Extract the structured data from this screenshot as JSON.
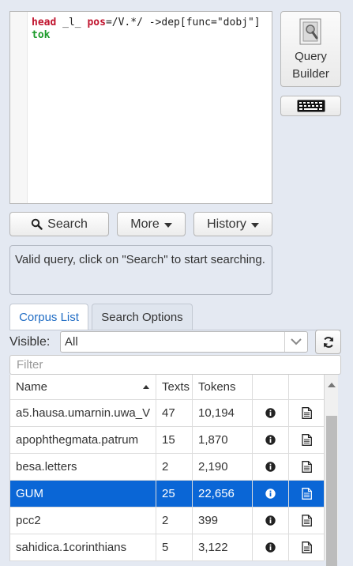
{
  "editor": {
    "query_parts": {
      "p1": "head",
      "p2": " _l_ ",
      "p3": "pos",
      "p4": "=/V.*/ -",
      "p5": ">dep[",
      "p6": "func",
      "p7": "=\"dobj\"] ",
      "p8": "tok"
    }
  },
  "query_builder": {
    "label": "Query Builder",
    "icon": "query-builder-icon"
  },
  "keyboard": {
    "icon": "keyboard-icon"
  },
  "buttons": {
    "search": "Search",
    "more": "More",
    "history": "History"
  },
  "status": {
    "message": "Valid query, click on \"Search\" to start searching."
  },
  "tabs": [
    {
      "label": "Corpus List",
      "active": true
    },
    {
      "label": "Search Options",
      "active": false
    }
  ],
  "visible": {
    "label": "Visible:",
    "value": "All"
  },
  "filter": {
    "placeholder": "Filter"
  },
  "table": {
    "columns": [
      "Name",
      "Texts",
      "Tokens"
    ],
    "rows": [
      {
        "name": "a5.hausa.umarnin.uwa_V",
        "texts": "47",
        "tokens": "10,194",
        "selected": false
      },
      {
        "name": "apophthegmata.patrum",
        "texts": "15",
        "tokens": "1,870",
        "selected": false
      },
      {
        "name": "besa.letters",
        "texts": "2",
        "tokens": "2,190",
        "selected": false
      },
      {
        "name": "GUM",
        "texts": "25",
        "tokens": "22,656",
        "selected": true
      },
      {
        "name": "pcc2",
        "texts": "2",
        "tokens": "399",
        "selected": false
      },
      {
        "name": "sahidica.1corinthians",
        "texts": "5",
        "tokens": "3,122",
        "selected": false
      }
    ]
  },
  "colors": {
    "accent": "#0a66d6",
    "tab_active_text": "#1f6cc4",
    "keyword": "#c0132d",
    "tok": "#1c9b2a"
  }
}
